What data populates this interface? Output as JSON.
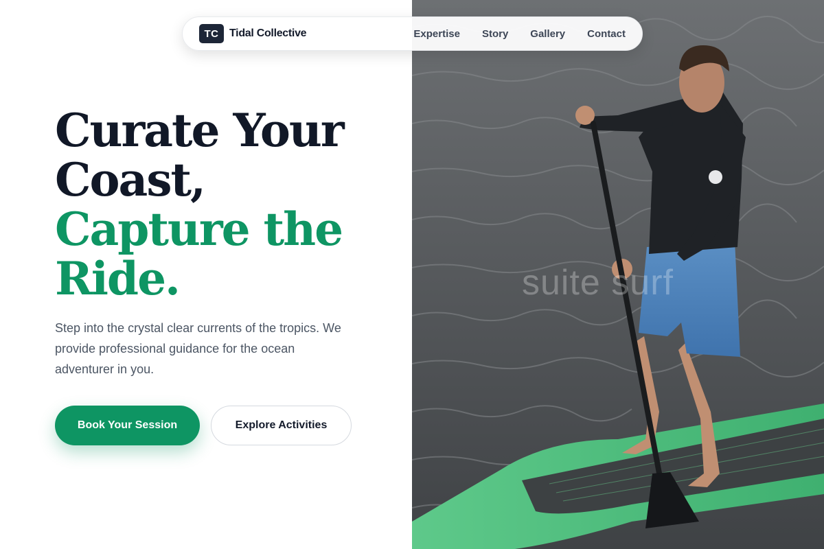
{
  "nav": {
    "brand_mark": "TC",
    "brand_name": "Tidal Collective",
    "links": [
      "Expertise",
      "Story",
      "Gallery",
      "Contact"
    ]
  },
  "hero": {
    "headline_line1": "Curate Your",
    "headline_line2": "Coast,",
    "headline_accent_line1": "Capture the",
    "headline_accent_line2": "Ride.",
    "lead": "Step into the crystal clear currents of the tropics. We provide professional guidance for the ocean adventurer in you.",
    "primary_button": "Book Your Session",
    "secondary_button": "Explore Activities"
  },
  "photo": {
    "watermark": "suite surf"
  },
  "colors": {
    "accent": "#0e9563",
    "heading": "#111827",
    "body": "#4b5563",
    "brand_mark_bg": "#1d2637"
  }
}
